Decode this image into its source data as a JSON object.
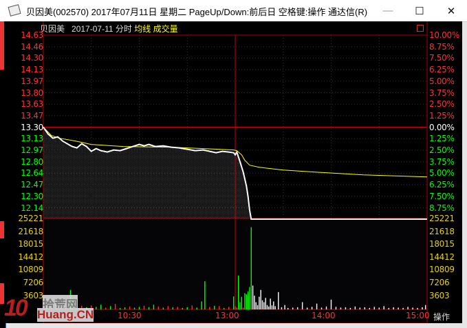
{
  "window": {
    "title": "贝因美(002570) 2017年07月11日 星期二 PageUp/Down:前后日 空格键:操作 通达信(R)",
    "minimize": "—",
    "maximize": "☐",
    "close": "✕"
  },
  "header": {
    "name": "贝因美",
    "date": "2017-07-11",
    "mode": "分时",
    "avg_label": "均线",
    "vol_label": "成交量"
  },
  "price_labels": [
    "14.63",
    "14.46",
    "14.30",
    "14.13",
    "13.97",
    "13.80",
    "13.63",
    "13.47",
    "13.30",
    "13.13",
    "12.97",
    "12.80",
    "12.64",
    "12.47",
    "12.30",
    "12.14"
  ],
  "pct_labels": [
    "10.00%",
    "8.75%",
    "7.50%",
    "6.25%",
    "5.00%",
    "3.75%",
    "2.50%",
    "1.25%",
    "0.00%",
    "1.25%",
    "2.50%",
    "3.75%",
    "5.00%",
    "6.25%",
    "7.50%",
    "8.75%"
  ],
  "vol_labels": [
    "25221",
    "21618",
    "18015",
    "14412",
    "10809",
    "7206",
    "3603"
  ],
  "time_labels": [
    "10:30",
    "13:00",
    "14:00",
    "15:00"
  ],
  "operate_label": "操作",
  "logo": {
    "text1": "10",
    "text2": "拾荒网",
    "text3": "Huang.CN"
  },
  "colors": {
    "up": "#ff3232",
    "down": "#00ff00",
    "flat": "#ffffff",
    "avg": "#ffff00",
    "price": "#ffffff",
    "grid": "#b00000"
  },
  "chart_data": {
    "type": "line",
    "prev_close": 13.3,
    "price_range": [
      11.97,
      14.63
    ],
    "vol_range": [
      0,
      25221
    ],
    "minutes": 240,
    "price": [
      [
        0,
        13.3
      ],
      [
        3,
        13.2
      ],
      [
        6,
        13.14
      ],
      [
        9,
        13.16
      ],
      [
        12,
        13.1
      ],
      [
        15,
        13.06
      ],
      [
        18,
        13.02
      ],
      [
        21,
        13.0
      ],
      [
        24,
        13.06
      ],
      [
        27,
        13.02
      ],
      [
        30,
        12.95
      ],
      [
        33,
        12.99
      ],
      [
        36,
        12.96
      ],
      [
        40,
        12.94
      ],
      [
        44,
        12.97
      ],
      [
        48,
        12.96
      ],
      [
        52,
        12.99
      ],
      [
        56,
        13.02
      ],
      [
        60,
        13.05
      ],
      [
        63,
        13.03
      ],
      [
        66,
        13.05
      ],
      [
        70,
        13.02
      ],
      [
        75,
        13.03
      ],
      [
        80,
        13.01
      ],
      [
        85,
        13.0
      ],
      [
        90,
        12.98
      ],
      [
        95,
        12.96
      ],
      [
        100,
        12.97
      ],
      [
        104,
        12.95
      ],
      [
        108,
        12.93
      ],
      [
        112,
        12.95
      ],
      [
        116,
        12.94
      ],
      [
        119,
        12.93
      ],
      [
        120,
        12.9
      ],
      [
        121,
        12.94
      ],
      [
        123,
        12.8
      ],
      [
        125,
        12.65
      ],
      [
        127,
        12.45
      ],
      [
        128,
        12.3
      ],
      [
        129,
        12.1
      ],
      [
        130,
        11.97
      ],
      [
        240,
        11.97
      ]
    ],
    "avg": [
      [
        0,
        13.3
      ],
      [
        5,
        13.18
      ],
      [
        10,
        13.14
      ],
      [
        20,
        13.1
      ],
      [
        30,
        13.05
      ],
      [
        50,
        13.02
      ],
      [
        80,
        13.01
      ],
      [
        100,
        12.99
      ],
      [
        119,
        12.97
      ],
      [
        121,
        12.96
      ],
      [
        124,
        12.9
      ],
      [
        126,
        12.82
      ],
      [
        129,
        12.75
      ],
      [
        135,
        12.72
      ],
      [
        150,
        12.68
      ],
      [
        170,
        12.65
      ],
      [
        200,
        12.61
      ],
      [
        240,
        12.58
      ]
    ],
    "volume": [
      [
        2,
        900,
        "down"
      ],
      [
        5,
        600,
        "up"
      ],
      [
        8,
        1200,
        "down"
      ],
      [
        11,
        700,
        "down"
      ],
      [
        14,
        500,
        "up"
      ],
      [
        17,
        5400,
        "down"
      ],
      [
        18,
        1500,
        "down"
      ],
      [
        21,
        800,
        "down"
      ],
      [
        24,
        1000,
        "up"
      ],
      [
        27,
        600,
        "down"
      ],
      [
        30,
        1100,
        "up"
      ],
      [
        33,
        700,
        "down"
      ],
      [
        36,
        1300,
        "down"
      ],
      [
        39,
        500,
        "up"
      ],
      [
        42,
        900,
        "down"
      ],
      [
        45,
        1500,
        "up"
      ],
      [
        48,
        400,
        "down"
      ],
      [
        51,
        600,
        "down"
      ],
      [
        54,
        800,
        "up"
      ],
      [
        57,
        500,
        "down"
      ],
      [
        60,
        700,
        "down"
      ],
      [
        63,
        1000,
        "up"
      ],
      [
        66,
        600,
        "down"
      ],
      [
        69,
        1300,
        "down"
      ],
      [
        72,
        800,
        "up"
      ],
      [
        75,
        500,
        "down"
      ],
      [
        78,
        900,
        "up"
      ],
      [
        81,
        600,
        "down"
      ],
      [
        84,
        700,
        "up"
      ],
      [
        87,
        400,
        "down"
      ],
      [
        90,
        600,
        "down"
      ],
      [
        93,
        1100,
        "up"
      ],
      [
        96,
        500,
        "down"
      ],
      [
        99,
        2200,
        "down"
      ],
      [
        101,
        7800,
        "down"
      ],
      [
        104,
        700,
        "up"
      ],
      [
        107,
        1000,
        "down"
      ],
      [
        110,
        900,
        "up"
      ],
      [
        113,
        400,
        "down"
      ],
      [
        116,
        700,
        "up"
      ],
      [
        119,
        3600,
        "down"
      ],
      [
        120,
        800,
        "up"
      ],
      [
        121,
        500,
        "up"
      ],
      [
        122,
        9400,
        "down"
      ],
      [
        123,
        2000,
        "down"
      ],
      [
        124,
        3500,
        "down"
      ],
      [
        125,
        500,
        "up"
      ],
      [
        126,
        4500,
        "down"
      ],
      [
        127,
        4200,
        "down"
      ],
      [
        128,
        5000,
        "down"
      ],
      [
        129,
        6200,
        "down"
      ],
      [
        130,
        22800,
        "down"
      ],
      [
        131,
        6600,
        "flat"
      ],
      [
        132,
        3800,
        "flat"
      ],
      [
        133,
        2000,
        "flat"
      ],
      [
        134,
        1200,
        "flat"
      ],
      [
        135,
        3500,
        "flat"
      ],
      [
        136,
        5400,
        "flat"
      ],
      [
        137,
        2500,
        "flat"
      ],
      [
        138,
        2000,
        "flat"
      ],
      [
        139,
        3200,
        "flat"
      ],
      [
        140,
        1200,
        "flat"
      ],
      [
        141,
        800,
        "flat"
      ],
      [
        142,
        3000,
        "flat"
      ],
      [
        143,
        1100,
        "flat"
      ],
      [
        144,
        2200,
        "flat"
      ],
      [
        145,
        900,
        "flat"
      ],
      [
        147,
        4800,
        "flat"
      ],
      [
        149,
        600,
        "flat"
      ],
      [
        151,
        1200,
        "flat"
      ],
      [
        153,
        400,
        "flat"
      ],
      [
        156,
        500,
        "flat"
      ],
      [
        159,
        600,
        "flat"
      ],
      [
        162,
        2000,
        "flat"
      ],
      [
        165,
        500,
        "flat"
      ],
      [
        168,
        700,
        "flat"
      ],
      [
        171,
        1600,
        "flat"
      ],
      [
        174,
        500,
        "flat"
      ],
      [
        177,
        800,
        "flat"
      ],
      [
        180,
        2700,
        "flat"
      ],
      [
        183,
        700,
        "flat"
      ],
      [
        186,
        500,
        "flat"
      ],
      [
        189,
        600,
        "flat"
      ],
      [
        192,
        400,
        "flat"
      ],
      [
        195,
        800,
        "flat"
      ],
      [
        198,
        500,
        "flat"
      ],
      [
        201,
        600,
        "flat"
      ],
      [
        204,
        400,
        "flat"
      ],
      [
        207,
        700,
        "flat"
      ],
      [
        210,
        500,
        "flat"
      ],
      [
        213,
        900,
        "flat"
      ],
      [
        216,
        400,
        "flat"
      ],
      [
        219,
        600,
        "flat"
      ],
      [
        222,
        500,
        "flat"
      ],
      [
        225,
        400,
        "flat"
      ],
      [
        228,
        700,
        "flat"
      ],
      [
        231,
        500,
        "flat"
      ],
      [
        234,
        400,
        "flat"
      ],
      [
        237,
        600,
        "flat"
      ],
      [
        239,
        1200,
        "flat"
      ]
    ]
  }
}
